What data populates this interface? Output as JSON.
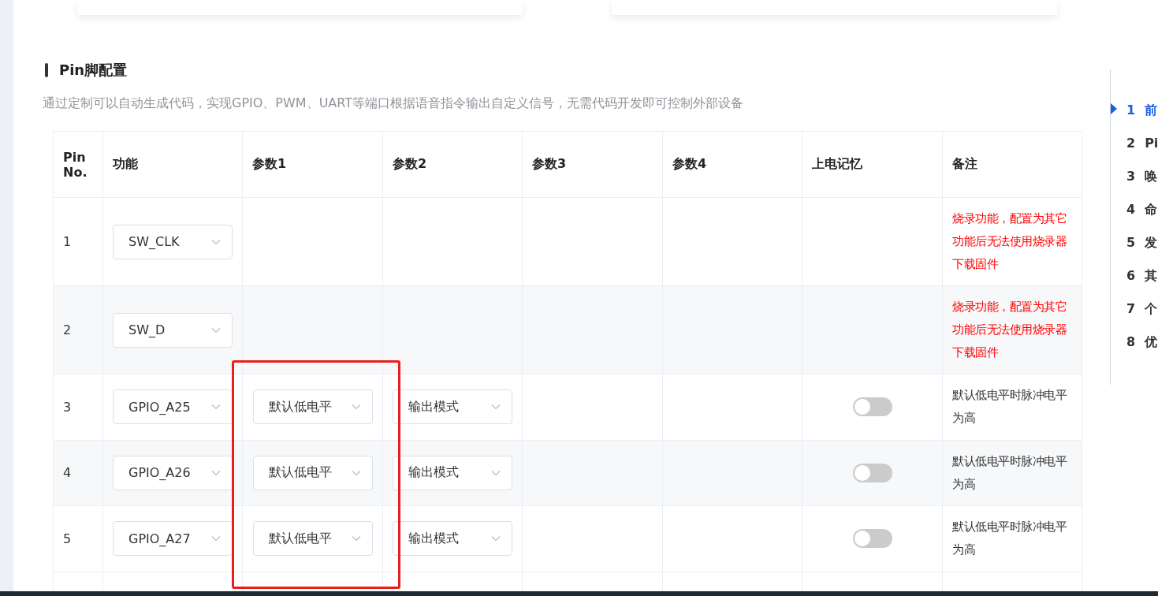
{
  "section": {
    "title": "Pin脚配置",
    "description": "通过定制可以自动生成代码，实现GPIO、PWM、UART等端口根据语音指令输出自定义信号，无需代码开发即可控制外部设备"
  },
  "table": {
    "columns": [
      "Pin No.",
      "功能",
      "参数1",
      "参数2",
      "参数3",
      "参数4",
      "上电记忆",
      "备注"
    ],
    "rows": [
      {
        "pin": "1",
        "function": "SW_CLK",
        "note": "烧录功能，配置为其它功能后无法使用烧录器下载固件",
        "color": "#ff0000"
      },
      {
        "pin": "2",
        "function": "SW_D",
        "note": "烧录功能，配置为其它功能后无法使用烧录器下载固件",
        "color": "#ff0000"
      },
      {
        "pin": "3",
        "function": "GPIO_A25",
        "param1": "默认低电平",
        "param2": "输出模式",
        "memory": {
          "on": false
        },
        "note": "默认低电平时脉冲电平为高",
        "color": "#333333"
      },
      {
        "pin": "4",
        "function": "GPIO_A26",
        "param1": "默认低电平",
        "param2": "输出模式",
        "memory": {
          "on": false
        },
        "note": "默认低电平时脉冲电平为高",
        "color": "#333333"
      },
      {
        "pin": "5",
        "function": "GPIO_A27",
        "param1": "默认低电平",
        "param2": "输出模式",
        "memory": {
          "on": false
        },
        "note": "默认低电平时脉冲电平为高",
        "color": "#333333"
      }
    ]
  },
  "toc": [
    {
      "number": "1",
      "label": "前",
      "selected": true
    },
    {
      "number": "2",
      "label": "Pi",
      "selected": false
    },
    {
      "number": "3",
      "label": "唤",
      "selected": false
    },
    {
      "number": "4",
      "label": "命",
      "selected": false
    },
    {
      "number": "5",
      "label": "发",
      "selected": false
    },
    {
      "number": "6",
      "label": "其",
      "selected": false
    },
    {
      "number": "7",
      "label": "个",
      "selected": false
    },
    {
      "number": "8",
      "label": "优",
      "selected": false
    }
  ]
}
